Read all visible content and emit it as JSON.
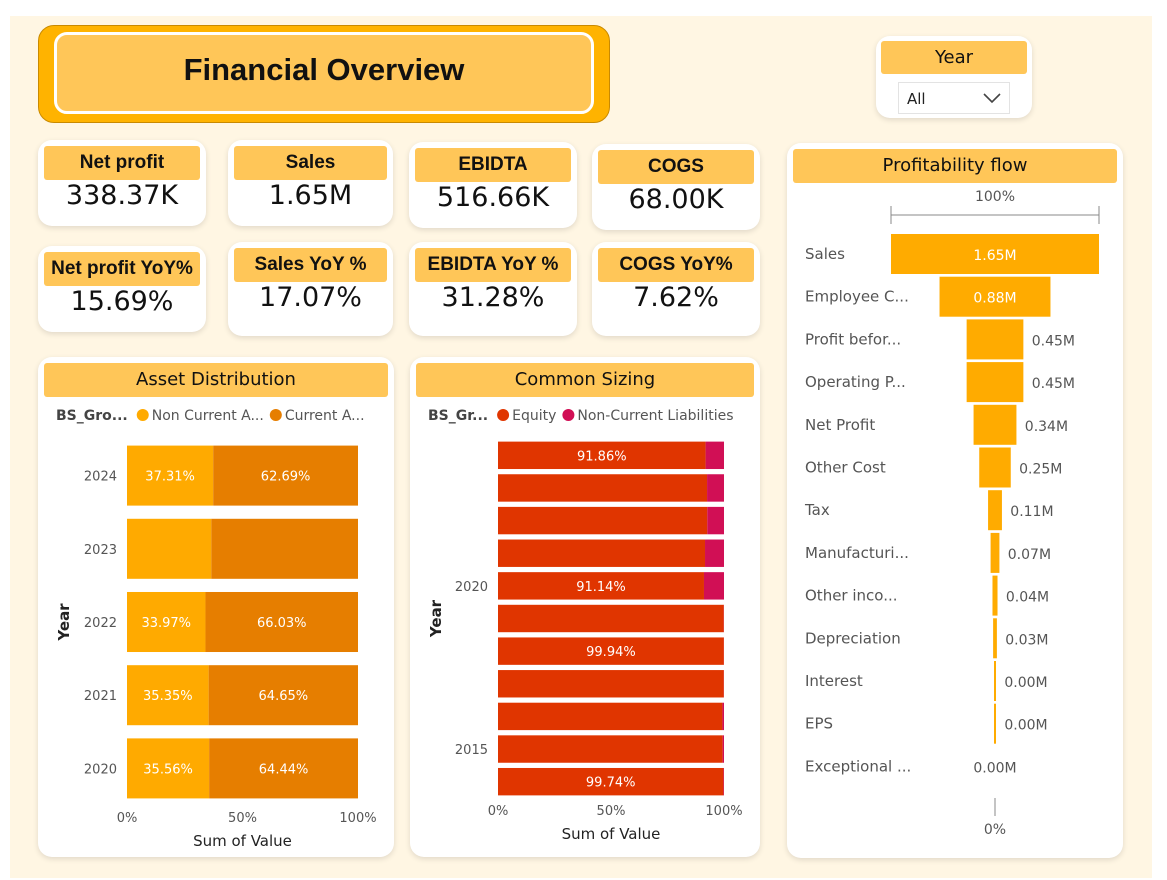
{
  "title": "Financial Overview",
  "slicer": {
    "label": "Year",
    "value": "All"
  },
  "kpis": [
    {
      "label": "Net profit",
      "value": "338.37K"
    },
    {
      "label": "Sales",
      "value": "1.65M"
    },
    {
      "label": "EBIDTA",
      "value": "516.66K"
    },
    {
      "label": "COGS",
      "value": "68.00K"
    },
    {
      "label": "Net profit YoY%",
      "value": "15.69%"
    },
    {
      "label": "Sales YoY %",
      "value": "17.07%"
    },
    {
      "label": "EBIDTA YoY %",
      "value": "31.28%"
    },
    {
      "label": "COGS YoY%",
      "value": "7.62%"
    }
  ],
  "colors": {
    "header_fill": "#ffc658",
    "title_fill": "#ffb300",
    "orange_light": "#ffaa00",
    "orange_dark": "#e67e00",
    "equity": "#e03500",
    "liabilities": "#d10f55",
    "funnel": "#ffab00",
    "background": "#fff6e3"
  },
  "chart_data": [
    {
      "type": "bar",
      "orientation": "horizontal-stacked-100",
      "title": "Asset Distribution",
      "legend_title": "BS_Gro...",
      "legend_position": "top-left",
      "ylabel": "Year",
      "xlabel": "Sum of Value",
      "x_ticks": [
        "0%",
        "50%",
        "100%"
      ],
      "categories": [
        "2024",
        "2023",
        "2022",
        "2021",
        "2020"
      ],
      "series": [
        {
          "name": "Non Current A...",
          "color": "#ffaa00",
          "values": [
            37.31,
            36.5,
            33.97,
            35.35,
            35.56
          ],
          "labels": [
            "37.31%",
            "",
            "33.97%",
            "35.35%",
            "35.56%"
          ]
        },
        {
          "name": "Current A...",
          "color": "#e67e00",
          "values": [
            62.69,
            63.5,
            66.03,
            64.65,
            64.44
          ],
          "labels": [
            "62.69%",
            "",
            "66.03%",
            "64.65%",
            "64.44%"
          ]
        }
      ]
    },
    {
      "type": "bar",
      "orientation": "horizontal-stacked-100",
      "title": "Common Sizing",
      "legend_title": "BS_Gr...",
      "legend_position": "top-left",
      "ylabel": "Year",
      "xlabel": "Sum of Value",
      "x_ticks": [
        "0%",
        "50%",
        "100%"
      ],
      "y_tick_labels": [
        {
          "row": 4,
          "text": "2020"
        },
        {
          "row": 9,
          "text": "2015"
        }
      ],
      "series": [
        {
          "name": "Equity",
          "color": "#e03500",
          "values": [
            91.86,
            92.5,
            92.6,
            91.6,
            91.14,
            99.9,
            99.94,
            99.92,
            99.3,
            99.4,
            99.74
          ],
          "labels": [
            "91.86%",
            "",
            "",
            "",
            "91.14%",
            "",
            "99.94%",
            "",
            "",
            "",
            "99.74%"
          ]
        },
        {
          "name": "Non-Current Liabilities",
          "color": "#d10f55",
          "values": [
            8.14,
            7.5,
            7.4,
            8.4,
            8.86,
            0.1,
            0.06,
            0.08,
            0.7,
            0.6,
            0.26
          ],
          "labels": [
            "",
            "",
            "",
            "",
            "",
            "",
            "",
            "",
            "",
            "",
            ""
          ]
        }
      ]
    },
    {
      "type": "bar",
      "orientation": "funnel",
      "title": "Profitability flow",
      "top_label": "100%",
      "bottom_label": "0%",
      "categories": [
        "Sales",
        "Employee C...",
        "Profit befor...",
        "Operating P...",
        "Net Profit",
        "Other Cost",
        "Tax",
        "Manufacturi...",
        "Other inco...",
        "Depreciation",
        "Interest",
        "EPS",
        "Exceptional ..."
      ],
      "values": [
        1.65,
        0.88,
        0.45,
        0.45,
        0.34,
        0.25,
        0.11,
        0.07,
        0.04,
        0.03,
        0.0,
        0.0,
        0.0
      ],
      "labels": [
        "1.65M",
        "0.88M",
        "0.45M",
        "0.45M",
        "0.34M",
        "0.25M",
        "0.11M",
        "0.07M",
        "0.04M",
        "0.03M",
        "0.00M",
        "0.00M",
        "0.00M"
      ]
    }
  ]
}
